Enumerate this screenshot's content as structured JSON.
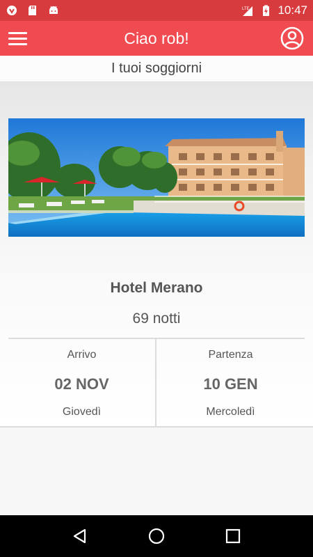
{
  "status_bar": {
    "time": "10:47",
    "network": "LTE",
    "icons": [
      "notification-icon",
      "sd-card-icon",
      "android-icon",
      "signal-icon",
      "battery-charging-icon"
    ]
  },
  "app_bar": {
    "title": "Ciao rob!",
    "menu_icon": "hamburger-menu-icon",
    "account_icon": "account-circle-icon",
    "color": "#f04b50"
  },
  "section": {
    "title": "I tuoi soggiorni"
  },
  "stay": {
    "hotel_name": "Hotel Merano",
    "nights": "69 notti",
    "arrival": {
      "label": "Arrivo",
      "date": "02 NOV",
      "weekday": "Giovedì"
    },
    "departure": {
      "label": "Partenza",
      "date": "10 GEN",
      "weekday": "Mercoledì"
    }
  },
  "nav_bar": {
    "buttons": [
      "back-icon",
      "home-icon",
      "recents-icon"
    ]
  }
}
